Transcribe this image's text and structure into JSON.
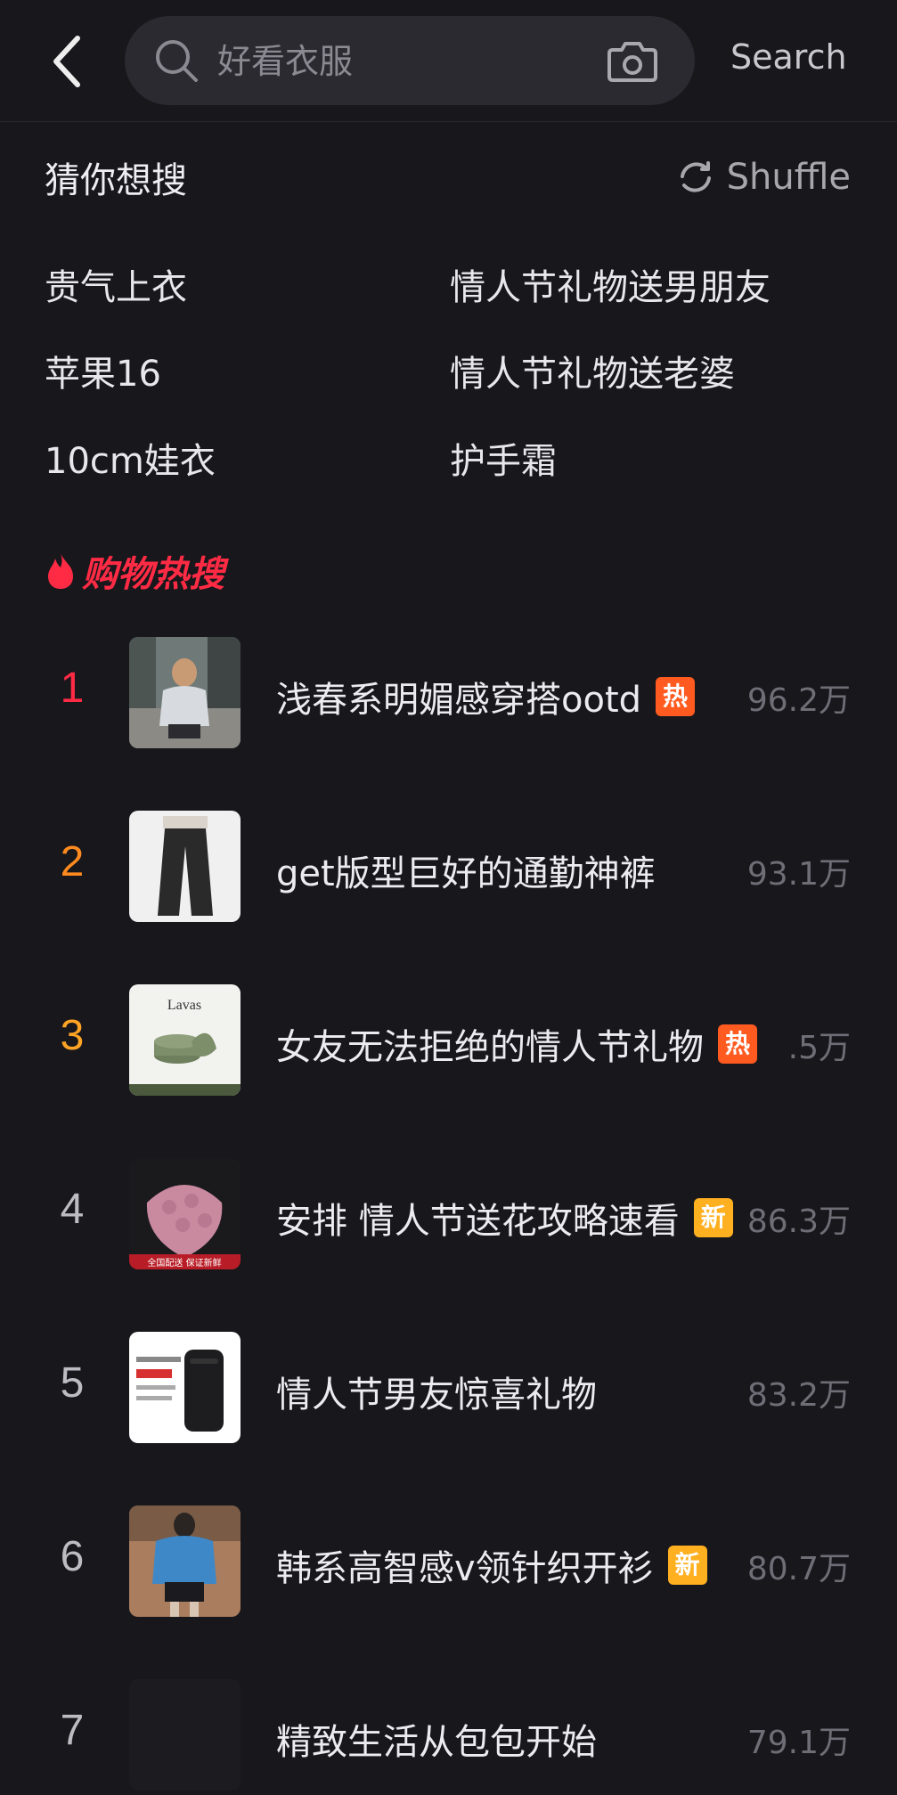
{
  "search": {
    "placeholder": "好看衣服",
    "button_label": "Search"
  },
  "guess": {
    "title": "猜你想搜",
    "shuffle_label": "Shuffle",
    "items": [
      "贵气上衣",
      "情人节礼物送男朋友",
      "苹果16",
      "情人节礼物送老婆",
      "10cm娃衣",
      "护手霜"
    ]
  },
  "hot": {
    "title": "购物热搜",
    "items": [
      {
        "rank": "1",
        "label": "浅春系明媚感穿搭ootd",
        "badge": "热",
        "count": "96.2万",
        "rank_color": "#ff2b45"
      },
      {
        "rank": "2",
        "label": "get版型巨好的通勤神裤",
        "badge": "",
        "count": "93.1万",
        "rank_color": "#ff8a1f"
      },
      {
        "rank": "3",
        "label": "女友无法拒绝的情人节礼物",
        "badge": "热",
        "count": ".5万",
        "rank_color": "#ffa425"
      },
      {
        "rank": "4",
        "label": "安排 情人节送花攻略速看",
        "badge": "新",
        "count": "86.3万",
        "rank_color": "#bdbcc3"
      },
      {
        "rank": "5",
        "label": "情人节男友惊喜礼物",
        "badge": "",
        "count": "83.2万",
        "rank_color": "#bdbcc3"
      },
      {
        "rank": "6",
        "label": "韩系高智感v领针织开衫",
        "badge": "新",
        "count": "80.7万",
        "rank_color": "#bdbcc3"
      },
      {
        "rank": "7",
        "label": "精致生活从包包开始",
        "badge": "",
        "count": "79.1万",
        "rank_color": "#bdbcc3"
      }
    ]
  },
  "thumbnails": {
    "t1_image": "street-outfit-photo",
    "t2_image": "wide-leg-trousers-photo",
    "t3_image": "jewelry-box-photo",
    "t3_brand": "Lavas",
    "t4_image": "rose-bouquet-photo",
    "t4_tag": "全国配送 保证新鲜",
    "t5_image": "smart-device-photo",
    "t6_image": "cardigan-outfit-photo"
  },
  "colors": {
    "hot_red": "#ff2b45",
    "badge_hot": "#ff5a1f",
    "badge_new": "#ffb020"
  },
  "icons": [
    "back-arrow-icon",
    "search-icon",
    "camera-icon",
    "shuffle-icon",
    "flame-icon"
  ]
}
